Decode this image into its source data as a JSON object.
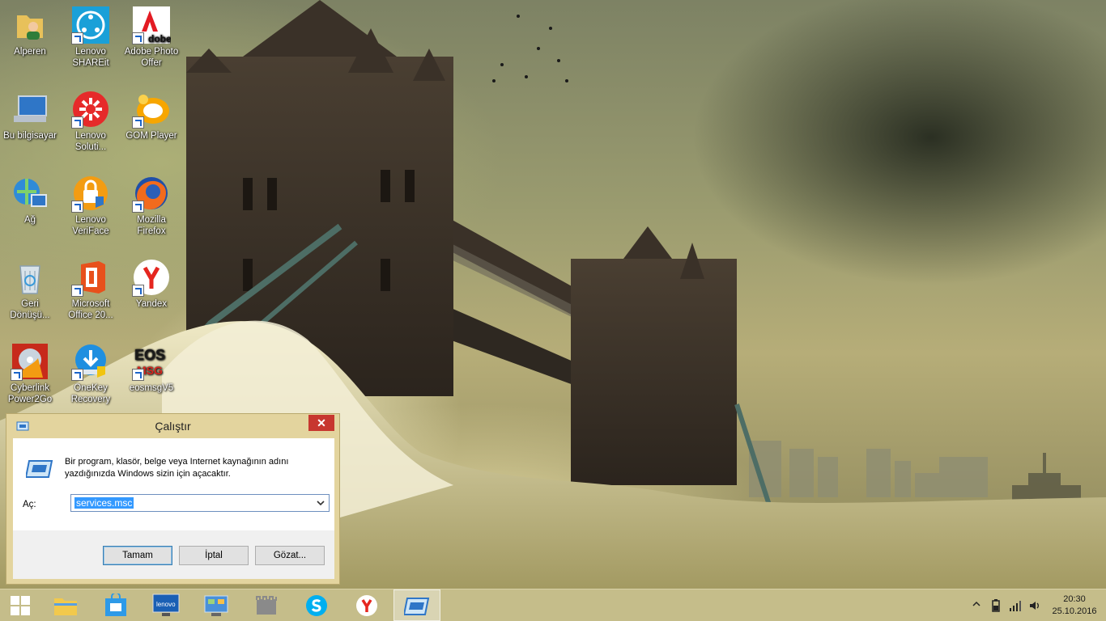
{
  "desktop": {
    "icons": [
      {
        "name": "Alperen",
        "icon": "user-folder-icon"
      },
      {
        "name": "Lenovo\nSHAREit",
        "icon": "shareit-icon"
      },
      {
        "name": "Adobe Photo\nOffer",
        "icon": "adobe-icon"
      },
      {
        "name": "Bu bilgisayar",
        "icon": "computer-icon"
      },
      {
        "name": "Lenovo\nSoluti...",
        "icon": "lenovo-solution-icon"
      },
      {
        "name": "GOM Player",
        "icon": "gom-player-icon"
      },
      {
        "name": "Ağ",
        "icon": "network-icon"
      },
      {
        "name": "Lenovo\nVeriFace",
        "icon": "veriface-icon"
      },
      {
        "name": "Mozilla\nFirefox",
        "icon": "firefox-icon"
      },
      {
        "name": "Geri\nDönüşü...",
        "icon": "recycle-bin-icon"
      },
      {
        "name": "Microsoft\nOffice 20...",
        "icon": "office-icon"
      },
      {
        "name": "Yandex",
        "icon": "yandex-icon"
      },
      {
        "name": "Cyberlink\nPower2Go",
        "icon": "power2go-icon"
      },
      {
        "name": "OneKey\nRecovery",
        "icon": "onekey-recovery-icon"
      },
      {
        "name": "eosmsgV5",
        "icon": "eosmsg-icon"
      }
    ],
    "adobe_logo_text": "dobe",
    "eos_logo_top": "EOS",
    "eos_logo_bottom": "MSG"
  },
  "run_dialog": {
    "title": "Çalıştır",
    "close_label": "✕",
    "description": "Bir program, klasör, belge veya Internet kaynağının adını yazdığınızda Windows sizin için açacaktır.",
    "open_label": "Aç:",
    "open_value": "services.msc",
    "ok_label": "Tamam",
    "cancel_label": "İptal",
    "browse_label": "Gözat..."
  },
  "taskbar": {
    "lenovo_text": "lenovo",
    "clock_time": "20:30",
    "clock_date": "25.10.2016"
  },
  "colors": {
    "taskbar": "#c5bd8a",
    "dialog_frame": "#e3d49e",
    "close_button": "#c7372f",
    "selection": "#3399ff"
  }
}
